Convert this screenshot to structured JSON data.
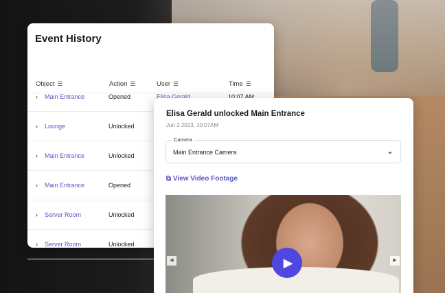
{
  "history": {
    "title": "Event History",
    "columns": [
      "Object",
      "Action",
      "User",
      "Time"
    ],
    "rows": [
      {
        "object": "Main Entrance",
        "action": "Opened",
        "user": "Elisa Gerald",
        "time": "10:07 AM"
      },
      {
        "object": "Lounge",
        "action": "Unlocked",
        "user": "",
        "time": ""
      },
      {
        "object": "Main Entrance",
        "action": "Unlocked",
        "user": "",
        "time": ""
      },
      {
        "object": "Main Entrance",
        "action": "Opened",
        "user": "",
        "time": ""
      },
      {
        "object": "Server Room",
        "action": "Unlocked",
        "user": "",
        "time": ""
      },
      {
        "object": "Server Room",
        "action": "Unlocked",
        "user": "",
        "time": ""
      }
    ]
  },
  "detail": {
    "title": "Elisa Gerald unlocked Main Entrance",
    "date": "Jun 2 2023, 10:07AM",
    "camera_label": "Camera",
    "camera_value": "Main Entrance Camera",
    "video_link": "View Video Footage"
  },
  "colors": {
    "accent": "#5a55c9",
    "play": "#5046e0"
  }
}
